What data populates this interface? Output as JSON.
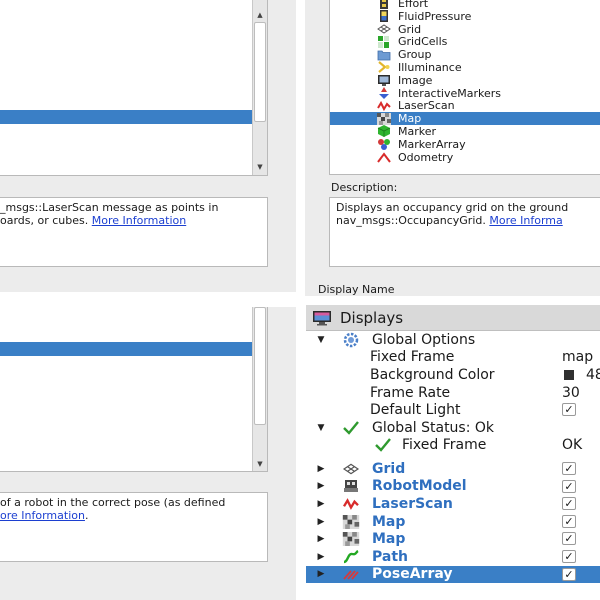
{
  "top_left": {
    "description_lines": [
      "_msgs::LaserScan message as points in",
      "oards, or cubes."
    ],
    "more_info_link": "More Information"
  },
  "top_right": {
    "display_types": [
      {
        "label": "Effort",
        "icon": "effort-icon"
      },
      {
        "label": "FluidPressure",
        "icon": "fluid-pressure-icon"
      },
      {
        "label": "Grid",
        "icon": "grid-icon"
      },
      {
        "label": "GridCells",
        "icon": "grid-cells-icon"
      },
      {
        "label": "Group",
        "icon": "folder-icon"
      },
      {
        "label": "Illuminance",
        "icon": "illuminance-icon"
      },
      {
        "label": "Image",
        "icon": "image-icon"
      },
      {
        "label": "InteractiveMarkers",
        "icon": "interactive-markers-icon"
      },
      {
        "label": "LaserScan",
        "icon": "laser-scan-icon"
      },
      {
        "label": "Map",
        "icon": "map-icon"
      },
      {
        "label": "Marker",
        "icon": "marker-icon"
      },
      {
        "label": "MarkerArray",
        "icon": "marker-array-icon"
      },
      {
        "label": "Odometry",
        "icon": "odometry-icon"
      }
    ],
    "selected_label": "Map",
    "description_heading": "Description:",
    "description_lines": [
      "Displays an occupancy grid on the ground",
      "nav_msgs::OccupancyGrid. "
    ],
    "more_info_link": "More Informa",
    "display_name_label": "Display Name"
  },
  "bottom_left": {
    "description_line": "of a robot in the correct pose (as defined",
    "more_info_link": "ore Information",
    "more_info_suffix": "."
  },
  "displays": {
    "title": "Displays",
    "global_options": {
      "label": "Global Options",
      "fixed_frame_label": "Fixed Frame",
      "fixed_frame_value": "map",
      "background_color_label": "Background Color",
      "background_color_value": "48",
      "frame_rate_label": "Frame Rate",
      "frame_rate_value": "30",
      "default_light_label": "Default Light",
      "default_light_checked": true
    },
    "global_status": {
      "label": "Global Status: Ok",
      "fixed_frame_label": "Fixed Frame",
      "fixed_frame_value": "OK"
    },
    "items": [
      {
        "label": "Grid",
        "icon": "grid-icon",
        "checked": true
      },
      {
        "label": "RobotModel",
        "icon": "robot-model-icon",
        "checked": true
      },
      {
        "label": "LaserScan",
        "icon": "laser-scan-icon",
        "checked": true
      },
      {
        "label": "Map",
        "icon": "map-icon",
        "checked": true
      },
      {
        "label": "Map",
        "icon": "map-icon",
        "checked": true
      },
      {
        "label": "Path",
        "icon": "path-icon",
        "checked": true
      },
      {
        "label": "PoseArray",
        "icon": "pose-array-icon",
        "checked": true
      }
    ],
    "selected_item": "PoseArray",
    "check_glyph": "✓"
  }
}
